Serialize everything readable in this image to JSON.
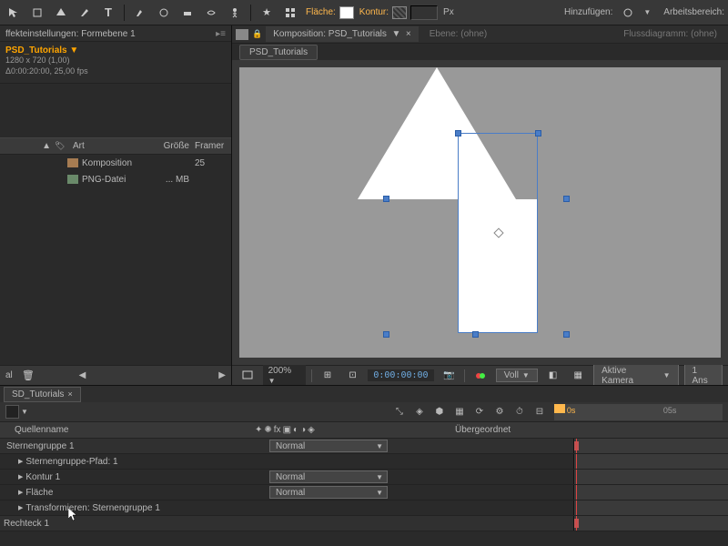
{
  "toolbar": {
    "fill_label": "Fläche:",
    "stroke_label": "Kontur:",
    "px_label": "Px",
    "add_label": "Hinzufügen:",
    "workspace_label": "Arbeitsbereich:"
  },
  "effects_panel": {
    "title": "ffekteinstellungen: Formebene 1"
  },
  "project": {
    "comp_name": "PSD_Tutorials ▼",
    "comp_res": "1280 x 720 (1,00)",
    "comp_dur": "Δ0:00:20:00, 25,00 fps",
    "col_art": "Art",
    "col_size": "Größe",
    "col_frame": "Framer",
    "row1_type": "Komposition",
    "row1_frame": "25",
    "row2_type": "PNG-Datei",
    "row2_size": "... MB",
    "footer_al": "al"
  },
  "comp_panel": {
    "tab_comp": "Komposition: PSD_Tutorials",
    "tab_layer": "Ebene: (ohne)",
    "tab_flow": "Flussdiagramm: (ohne)",
    "subtab": "PSD_Tutorials",
    "zoom": "200%",
    "timecode": "0:00:00:00",
    "res": "Voll",
    "camera": "Aktive Kamera",
    "view": "1 Ans"
  },
  "timeline": {
    "tab": "SD_Tutorials",
    "time_0s": "0s",
    "time_05s": "05s",
    "col_source": "Quellenname",
    "col_parent": "Übergeordnet",
    "mode_normal": "Normal",
    "layers": {
      "l1": "Sternengruppe 1",
      "l1a": "Sternengruppe-Pfad: 1",
      "l1b": "Kontur 1",
      "l1c": "Fläche",
      "l1d": "Transformieren: Sternengruppe 1",
      "l2": "Rechteck 1"
    }
  }
}
